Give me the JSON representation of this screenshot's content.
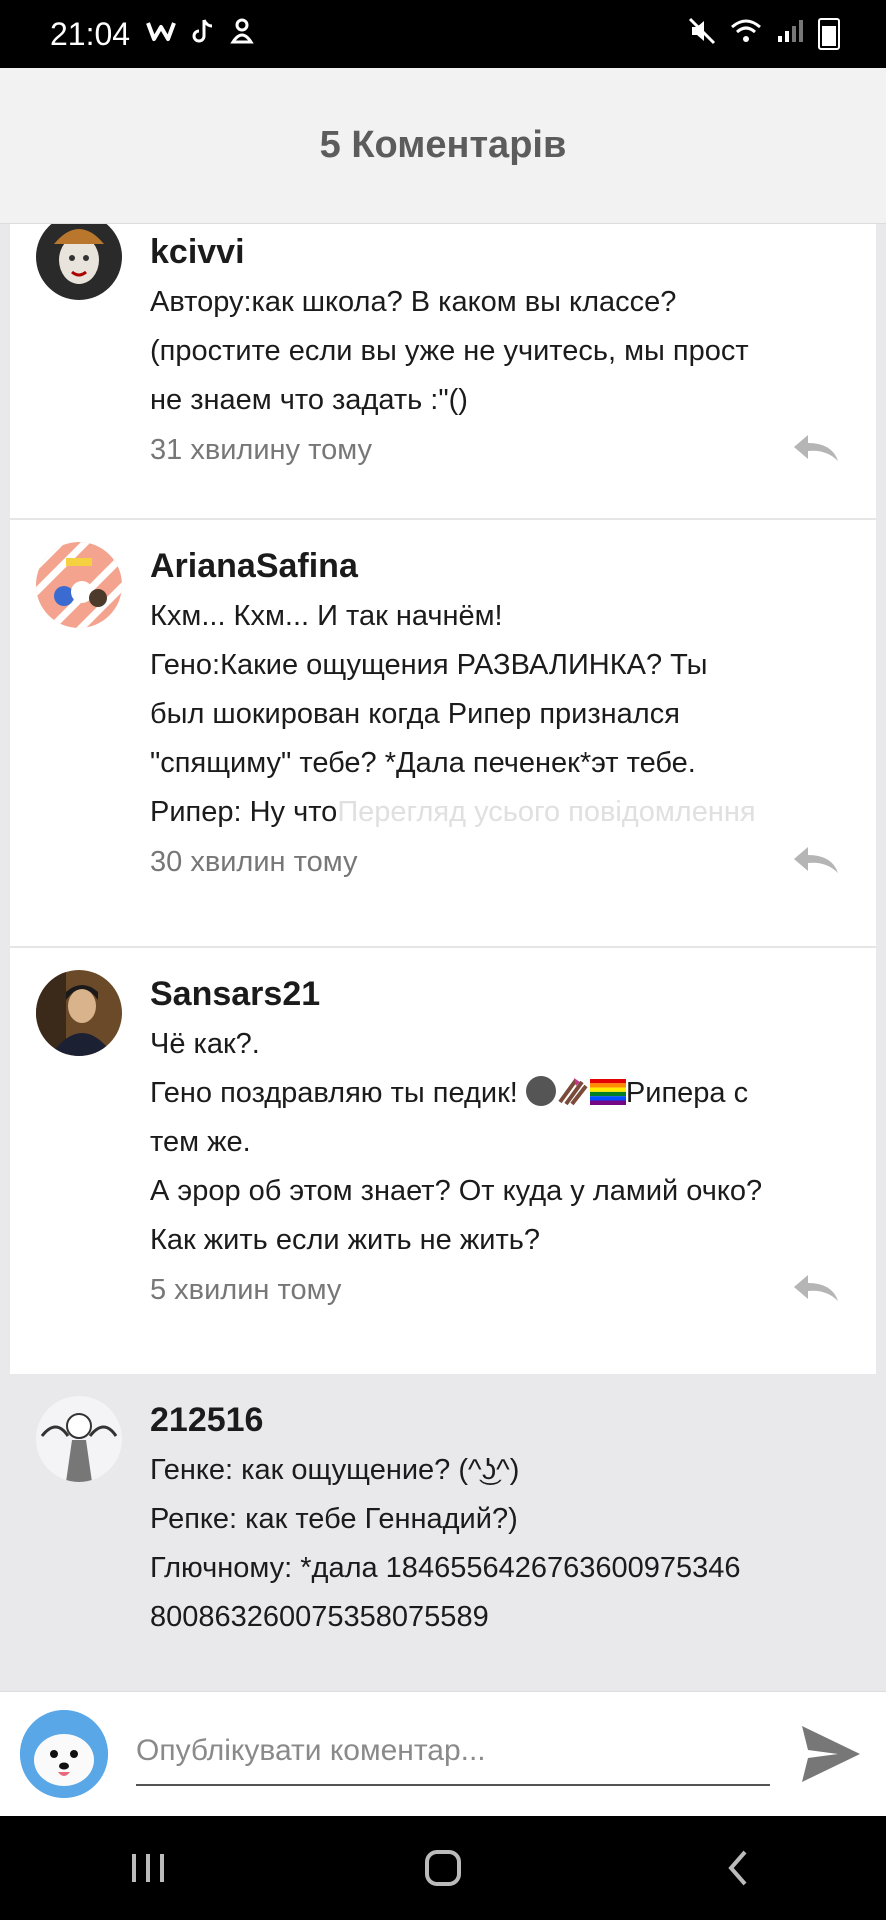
{
  "status_bar": {
    "time": "21:04",
    "left_icons": [
      "w-app-icon",
      "tiktok-icon",
      "notification-icon"
    ],
    "right_icons": [
      "mute-icon",
      "wifi-icon",
      "signal-icon",
      "battery-icon"
    ]
  },
  "header": {
    "title": "5 Коментарів"
  },
  "comments": [
    {
      "username": "kcivvi",
      "lines": [
        "Автору:как школа? В каком вы классе?",
        "(простите если вы уже не учитесь, мы прост",
        "не знаем что задать :\"()"
      ],
      "time": "31 хвилину тому"
    },
    {
      "username": "ArianaSafina",
      "lines": [
        "Кхм... Кхм... И так начнём!",
        "Гено:Какие ощущения РАЗВАЛИНКА? Ты",
        "был шокирован когда Рипер признался",
        "\"спящиму\" тебе? *Дала печенек*эт тебе.",
        "Рипер: Ну что"
      ],
      "more_link": "Перегляд усього повідомлення",
      "time": "30 хвилин тому"
    },
    {
      "username": "Sansars21",
      "lines": [
        "Чё как?.",
        "Гено поздравляю ты педик! ",
        "тем же.",
        "А эрор об этом знает? От куда у ламий очко?",
        "Как жить если жить не жить?"
      ],
      "line2_tail": "Рипера с",
      "time": "5 хвилин тому"
    },
    {
      "username": "212516",
      "lines": [
        "Генке: как ощущение? (^͜ʖ^)",
        "Репке: как тебе Геннадий?)",
        "Глючному: *дала 184655642676360097534​6",
        "800863260075358075589"
      ]
    }
  ],
  "composer": {
    "placeholder": "Опублікувати коментар..."
  },
  "colors": {
    "accent": "#5c5c5c",
    "muted": "#777777",
    "reply_icon": "#b5b5b5"
  }
}
